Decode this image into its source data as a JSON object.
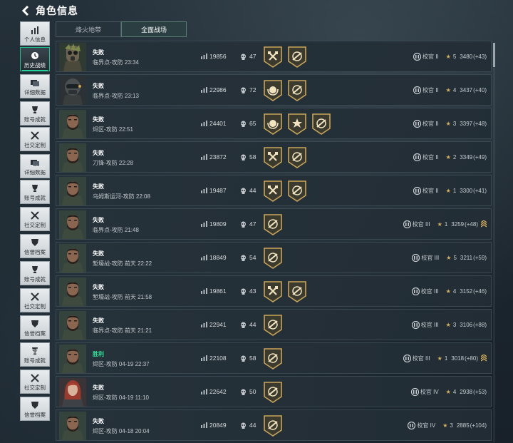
{
  "header": {
    "title": "角色信息"
  },
  "sidebar": {
    "items": [
      {
        "label": "个人信息",
        "icon": "bar-chart-icon"
      },
      {
        "label": "历史战绩",
        "icon": "clock-icon",
        "active": true
      },
      {
        "label": "详细数据",
        "icon": "cards-icon"
      },
      {
        "label": "账号成就",
        "icon": "trophy-icon"
      },
      {
        "label": "社交定制",
        "icon": "crossed-tools-icon"
      },
      {
        "label": "详细数据",
        "icon": "cards-icon"
      },
      {
        "label": "账号成就",
        "icon": "trophy-icon"
      },
      {
        "label": "社交定制",
        "icon": "crossed-tools-icon"
      },
      {
        "label": "信誉档案",
        "icon": "shield-icon"
      },
      {
        "label": "账号成就",
        "icon": "trophy-icon"
      },
      {
        "label": "社交定制",
        "icon": "crossed-tools-icon"
      },
      {
        "label": "信誉档案",
        "icon": "shield-icon"
      },
      {
        "label": "账号成就",
        "icon": "trophy-icon"
      },
      {
        "label": "社交定制",
        "icon": "crossed-tools-icon"
      },
      {
        "label": "信誉档案",
        "icon": "shield-icon"
      }
    ],
    "floating_labels": [
      "详细数据",
      "详细数据"
    ]
  },
  "tabs": [
    {
      "label": "烽火地带",
      "active": false
    },
    {
      "label": "全面战场",
      "active": true
    }
  ],
  "matches": [
    {
      "avatar": "gasmask",
      "result": "失败",
      "win": false,
      "mode": "临界点-攻防 23:34",
      "score": "19856",
      "kills": "47",
      "medals": [
        "axes",
        "rifle"
      ],
      "rank": "校官 II",
      "level": "5",
      "rating": "3480",
      "delta": "(+43)",
      "sgt": false
    },
    {
      "avatar": "helmet",
      "result": "失败",
      "win": false,
      "mode": "临界点-攻防 23:13",
      "score": "22986",
      "kills": "72",
      "medals": [
        "wreath",
        "rifle"
      ],
      "rank": "校官 II",
      "level": "4",
      "rating": "3437",
      "delta": "(+40)",
      "sgt": false
    },
    {
      "avatar": "bearded",
      "result": "失败",
      "win": false,
      "mode": "烬区-攻防 22:51",
      "score": "24401",
      "kills": "65",
      "medals": [
        "wreath",
        "star",
        "rifle"
      ],
      "rank": "校官 II",
      "level": "3",
      "rating": "3397",
      "delta": "(+48)",
      "sgt": false
    },
    {
      "avatar": "bearded",
      "result": "失败",
      "win": false,
      "mode": "刀锋-攻防 22:28",
      "score": "23872",
      "kills": "58",
      "medals": [
        "axes",
        "rifle"
      ],
      "rank": "校官 II",
      "level": "2",
      "rating": "3349",
      "delta": "(+49)",
      "sgt": false
    },
    {
      "avatar": "bearded",
      "result": "失败",
      "win": false,
      "mode": "乌姆斯运河-攻防 22:08",
      "score": "19487",
      "kills": "44",
      "medals": [
        "axes",
        "rifle"
      ],
      "rank": "校官 II",
      "level": "1",
      "rating": "3300",
      "delta": "(+41)",
      "sgt": false
    },
    {
      "avatar": "bearded",
      "result": "失败",
      "win": false,
      "mode": "临界点-攻防 21:48",
      "score": "19809",
      "kills": "47",
      "medals": [
        "rifle"
      ],
      "rank": "校官 III",
      "level": "1",
      "rating": "3259",
      "delta": "(+48)",
      "sgt": true
    },
    {
      "avatar": "bearded",
      "result": "失败",
      "win": false,
      "mode": "堑壕战-攻防 前天 22:22",
      "score": "18849",
      "kills": "54",
      "medals": [
        "rifle"
      ],
      "rank": "校官 III",
      "level": "5",
      "rating": "3211",
      "delta": "(+59)",
      "sgt": false
    },
    {
      "avatar": "bearded",
      "result": "失败",
      "win": false,
      "mode": "堑壕战-攻防 前天 21:58",
      "score": "19861",
      "kills": "43",
      "medals": [
        "axes",
        "rifle"
      ],
      "rank": "校官 III",
      "level": "4",
      "rating": "3152",
      "delta": "(+46)",
      "sgt": false
    },
    {
      "avatar": "bearded",
      "result": "失败",
      "win": false,
      "mode": "临界点-攻防 前天 21:21",
      "score": "22941",
      "kills": "44",
      "medals": [
        "rifle"
      ],
      "rank": "校官 III",
      "level": "3",
      "rating": "3106",
      "delta": "(+88)",
      "sgt": false
    },
    {
      "avatar": "bearded",
      "result": "胜利",
      "win": true,
      "mode": "烬区-攻防 04-19 22:37",
      "score": "22108",
      "kills": "58",
      "medals": [
        "rifle"
      ],
      "rank": "校官 III",
      "level": "1",
      "rating": "3018",
      "delta": "(+80)",
      "sgt": true
    },
    {
      "avatar": "redhair",
      "result": "失败",
      "win": false,
      "mode": "烬区-攻防 04-19 11:10",
      "score": "22642",
      "kills": "50",
      "medals": [
        "rifle"
      ],
      "rank": "校官 IV",
      "level": "4",
      "rating": "2938",
      "delta": "(+53)",
      "sgt": false
    },
    {
      "avatar": "bearded",
      "result": "失败",
      "win": false,
      "mode": "烬区-攻防 04-18 20:04",
      "score": "20849",
      "kills": "44",
      "medals": [
        "rifle"
      ],
      "rank": "校官 IV",
      "level": "3",
      "rating": "2885",
      "delta": "(+104)",
      "sgt": false
    }
  ],
  "colors": {
    "win": "#2fe29a",
    "accent": "#1fd49a",
    "medal_gold": "#c8a55a",
    "star": "#d9b25a"
  }
}
